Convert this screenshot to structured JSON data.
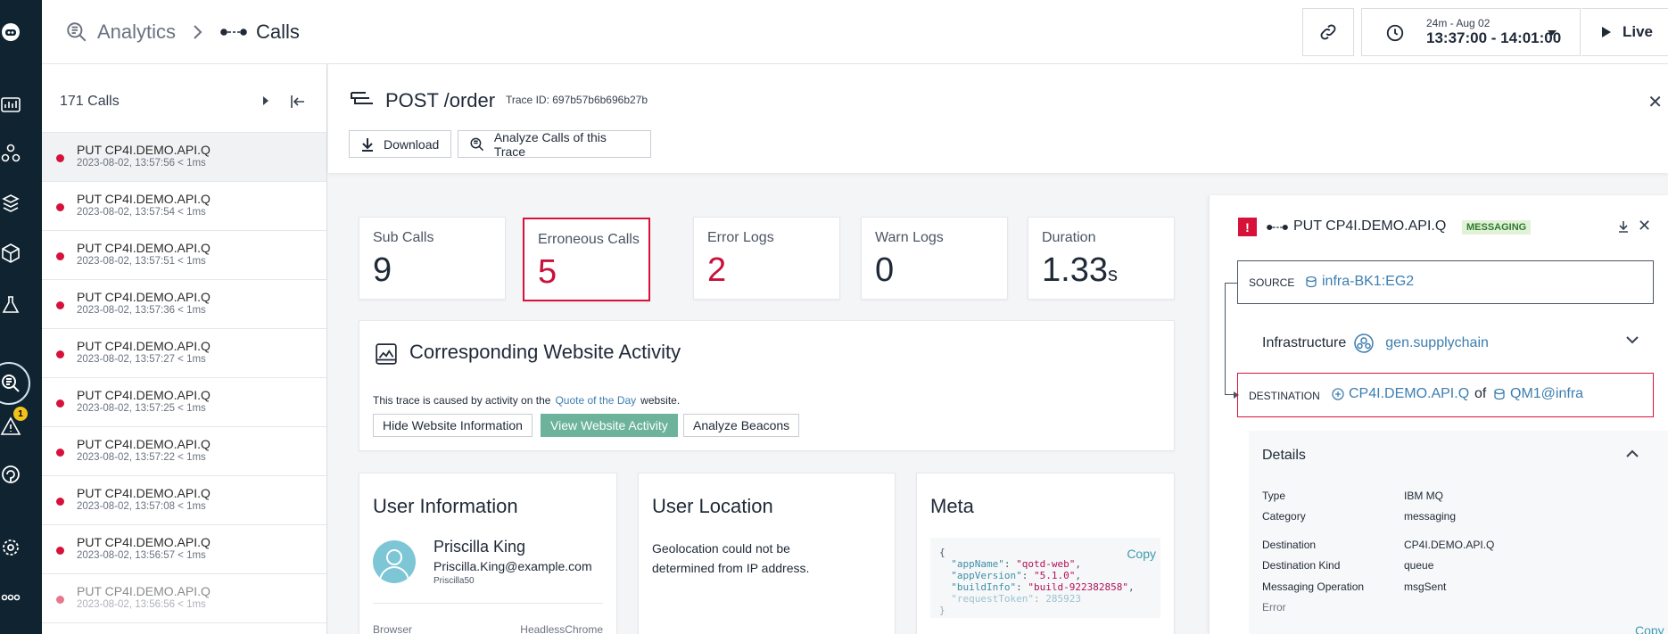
{
  "nav": {
    "items": [
      "agent-logo-icon",
      "dashboard-icon",
      "applications-icon",
      "services-icon",
      "infrastructure-icon",
      "pipeline-icon",
      "analytics-icon",
      "alerts-icon",
      "website-icon",
      "settings-icon",
      "more-icon"
    ],
    "active": "analytics-icon",
    "alerts_badge": "1"
  },
  "header": {
    "breadcrumb_root": "Analytics",
    "breadcrumb_current": "Calls",
    "time_range_label": "24m - Aug 02",
    "time_range_value": "13:37:00 - 14:01:00",
    "live_label": "Live"
  },
  "call_list": {
    "count_label": "171 Calls",
    "rows": [
      {
        "title": "PUT CP4I.DEMO.API.Q",
        "meta": "2023-08-02, 13:57:56  < 1ms",
        "selected": true
      },
      {
        "title": "PUT CP4I.DEMO.API.Q",
        "meta": "2023-08-02, 13:57:54  < 1ms"
      },
      {
        "title": "PUT CP4I.DEMO.API.Q",
        "meta": "2023-08-02, 13:57:51  < 1ms"
      },
      {
        "title": "PUT CP4I.DEMO.API.Q",
        "meta": "2023-08-02, 13:57:36  < 1ms"
      },
      {
        "title": "PUT CP4I.DEMO.API.Q",
        "meta": "2023-08-02, 13:57:27  < 1ms"
      },
      {
        "title": "PUT CP4I.DEMO.API.Q",
        "meta": "2023-08-02, 13:57:25  < 1ms"
      },
      {
        "title": "PUT CP4I.DEMO.API.Q",
        "meta": "2023-08-02, 13:57:22  < 1ms"
      },
      {
        "title": "PUT CP4I.DEMO.API.Q",
        "meta": "2023-08-02, 13:57:08  < 1ms"
      },
      {
        "title": "PUT CP4I.DEMO.API.Q",
        "meta": "2023-08-02, 13:56:57  < 1ms"
      },
      {
        "title": "PUT CP4I.DEMO.API.Q",
        "meta": "2023-08-02, 13:56:56  < 1ms"
      }
    ]
  },
  "trace": {
    "title": "POST /order",
    "trace_id_label": "Trace ID: 697b57b6b696b27b",
    "download_label": "Download",
    "analyze_label": "Analyze Calls of this Trace"
  },
  "stats": [
    {
      "label": "Sub Calls",
      "value": "9",
      "unit": ""
    },
    {
      "label": "Erroneous Calls",
      "value": "5",
      "unit": ""
    },
    {
      "label": "Error Logs",
      "value": "2",
      "unit": ""
    },
    {
      "label": "Warn Logs",
      "value": "0",
      "unit": ""
    },
    {
      "label": "Duration",
      "value": "1.33",
      "unit": "s"
    }
  ],
  "website_activity": {
    "title": "Corresponding Website Activity",
    "text_before": "This trace is caused by activity on the",
    "link": "Quote of the Day",
    "text_after": "website.",
    "hide_label": "Hide Website Information",
    "view_label": "View Website Activity",
    "beacons_label": "Analyze Beacons"
  },
  "user_info": {
    "title": "User Information",
    "name": "Priscilla King",
    "email": "Priscilla.King@example.com",
    "handle": "Priscilla50",
    "browser_label": "Browser",
    "browser_value": "HeadlessChrome"
  },
  "user_location": {
    "title": "User Location",
    "text": "Geolocation could not be determined from IP address."
  },
  "meta": {
    "title": "Meta",
    "copy_label": "Copy",
    "lines": [
      {
        "key": "\"appName\"",
        "value": "\"qotd-web\""
      },
      {
        "key": "\"appVersion\"",
        "value": "\"5.1.0\""
      },
      {
        "key": "\"buildInfo\"",
        "value": "\"build-922382858\""
      },
      {
        "key": "\"requestToken\"",
        "value": "285923"
      }
    ]
  },
  "call_detail": {
    "title": "PUT CP4I.DEMO.API.Q",
    "tag": "MESSAGING",
    "source_label": "SOURCE",
    "source_value": "infra-BK1:EG2",
    "infra_label": "Infrastructure",
    "infra_value": "gen.supplychain",
    "destination_label": "DESTINATION",
    "destination_value": "CP4I.DEMO.API.Q",
    "destination_of": "of",
    "destination_qm": "QM1@infra",
    "details_title": "Details",
    "details": [
      {
        "key": "Type",
        "value": "IBM MQ"
      },
      {
        "key": "Category",
        "value": "messaging"
      },
      {
        "key": "Destination",
        "value": "CP4I.DEMO.API.Q"
      },
      {
        "key": "Destination Kind",
        "value": "queue"
      },
      {
        "key": "Messaging Operation",
        "value": "msgSent"
      },
      {
        "key": "Error",
        "value": ""
      }
    ],
    "copy_label": "Copy"
  },
  "colors": {
    "error": "#d6123a",
    "link": "#3c7eb0",
    "rail": "#0f2330",
    "primary_button": "#6db39b"
  }
}
